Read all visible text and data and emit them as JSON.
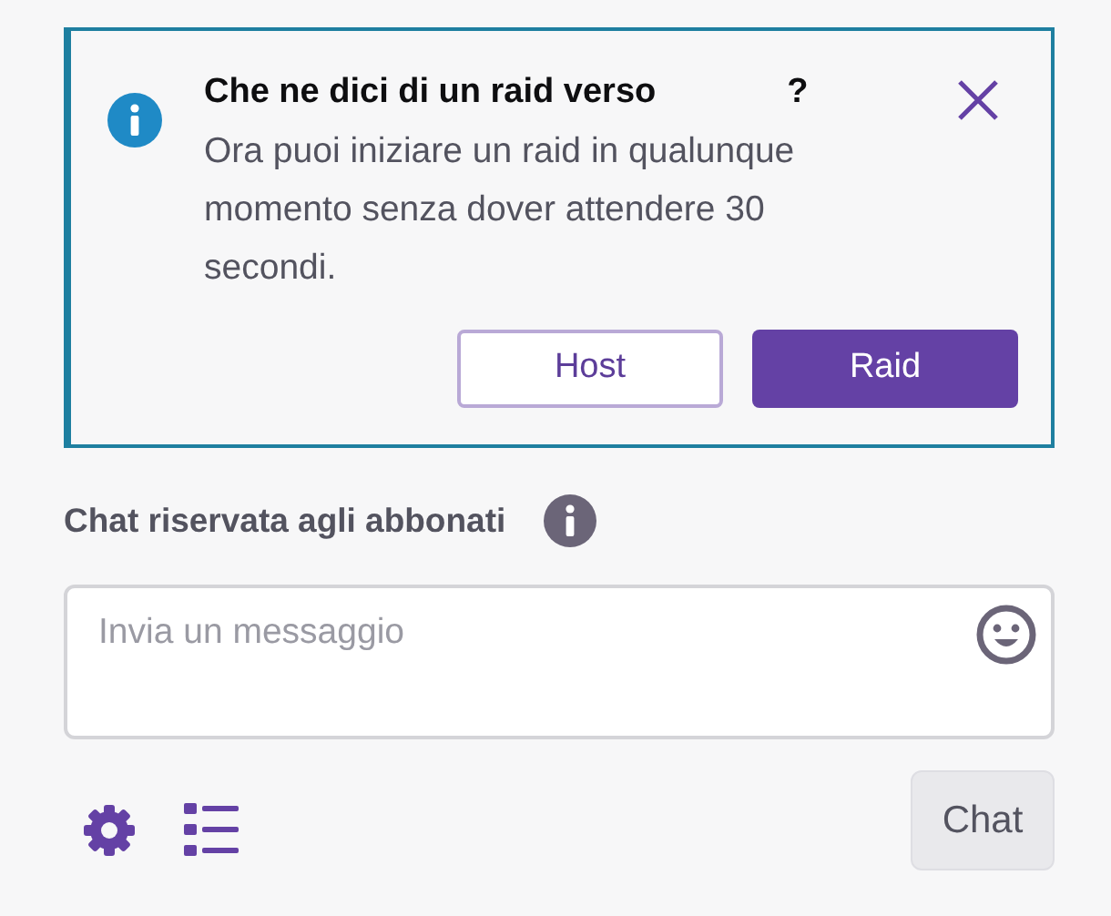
{
  "raid_notice": {
    "title": "Che ne dici di un raid verso",
    "title_end": "?",
    "message": "Ora puoi iniziare un raid in qualunque momento senza dover attendere 30 secondi.",
    "buttons": [
      {
        "label": "Host",
        "kind": "outline"
      },
      {
        "label": "Raid",
        "kind": "primary"
      }
    ]
  },
  "chat": {
    "mode_label": "Chat riservata agli abbonati",
    "input": {
      "placeholder": "Invia un messaggio"
    },
    "send_button": "Chat"
  }
}
